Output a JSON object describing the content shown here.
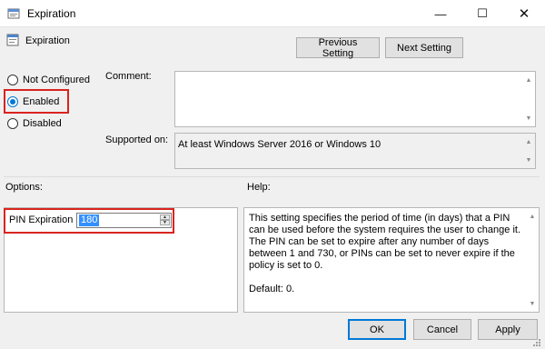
{
  "window": {
    "title": "Expiration",
    "icon": "policy-window-icon",
    "controls": {
      "minimize": "—",
      "maximize": "☐",
      "close": "✕"
    }
  },
  "header": {
    "setting_name": "Expiration",
    "icon": "setting-icon",
    "prev_label": "Previous Setting",
    "next_label": "Next Setting"
  },
  "state": {
    "options": [
      {
        "label": "Not Configured",
        "checked": false
      },
      {
        "label": "Enabled",
        "checked": true
      },
      {
        "label": "Disabled",
        "checked": false
      }
    ]
  },
  "comment": {
    "label": "Comment:",
    "value": ""
  },
  "supported": {
    "label": "Supported on:",
    "value": "At least Windows Server 2016 or Windows 10"
  },
  "options_section": {
    "label": "Options:",
    "pin_label": "PIN Expiration",
    "pin_value": "180"
  },
  "help_section": {
    "label": "Help:",
    "text": "This setting specifies the period of time (in days) that a PIN can be used before the system requires the user to change it. The PIN can be set to expire after any number of days between 1 and 730, or PINs can be set to never expire if the policy is set to 0.\n\nDefault: 0."
  },
  "footer": {
    "ok": "OK",
    "cancel": "Cancel",
    "apply": "Apply"
  },
  "colors": {
    "accent": "#0078d7",
    "highlight_box": "#d9231f",
    "selection": "#3390ff"
  }
}
